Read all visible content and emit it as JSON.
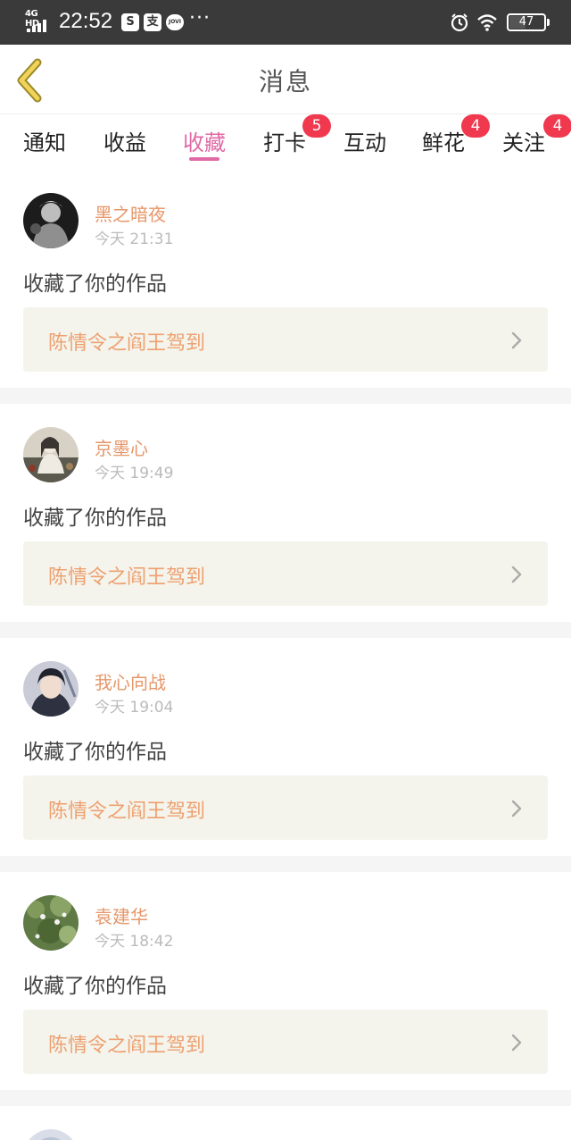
{
  "status_bar": {
    "network": "4G HD",
    "time": "22:52",
    "app_icons": [
      "S",
      "支"
    ],
    "jovi": "JOVI",
    "more": "···",
    "battery": "47",
    "battery_level": 0.47
  },
  "header": {
    "title": "消息",
    "back_icon": "chevron-left-icon",
    "accent_color": "#e06aa6"
  },
  "tabs": [
    {
      "label": "通知",
      "badge": ""
    },
    {
      "label": "收益",
      "badge": ""
    },
    {
      "label": "收藏",
      "badge": "",
      "active": true
    },
    {
      "label": "打卡",
      "badge": "5"
    },
    {
      "label": "互动",
      "badge": ""
    },
    {
      "label": "鲜花",
      "badge": "4"
    },
    {
      "label": "关注",
      "badge": "4"
    }
  ],
  "notifications": [
    {
      "user": "黑之暗夜",
      "time": "今天 21:31",
      "action": "收藏了你的作品",
      "work": "陈情令之阎王驾到"
    },
    {
      "user": "京墨心",
      "time": "今天 19:49",
      "action": "收藏了你的作品",
      "work": "陈情令之阎王驾到"
    },
    {
      "user": "我心向战",
      "time": "今天 19:04",
      "action": "收藏了你的作品",
      "work": "陈情令之阎王驾到"
    },
    {
      "user": "袁建华",
      "time": "今天 18:42",
      "action": "收藏了你的作品",
      "work": "陈情令之阎王驾到"
    }
  ]
}
